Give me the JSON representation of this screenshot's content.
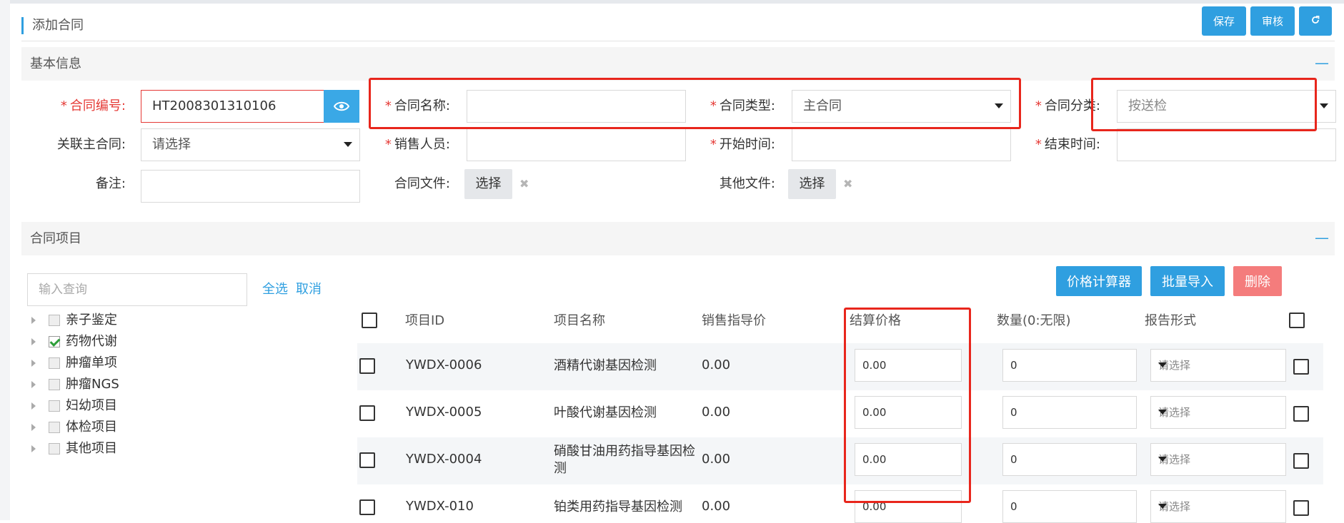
{
  "page": {
    "title": "添加合同"
  },
  "toolbar": {
    "save_label": "保存",
    "audit_label": "审核",
    "refresh_icon": "refresh-icon",
    "accent": "#2f9fe0"
  },
  "basic": {
    "section_label": "基本信息",
    "collapse": "—",
    "contract_no": {
      "label": "合同编号:",
      "value": "HT2008301310106"
    },
    "contract_name": {
      "label": "合同名称:",
      "value": ""
    },
    "contract_type": {
      "label": "合同类型:",
      "value": "主合同"
    },
    "contract_category": {
      "label": "合同分类:",
      "placeholder": "按送检"
    },
    "related_main": {
      "label": "关联主合同:",
      "value": "请选择"
    },
    "sales": {
      "label": "销售人员:",
      "value": ""
    },
    "start_time": {
      "label": "开始时间:",
      "value": ""
    },
    "end_time": {
      "label": "结束时间:",
      "value": ""
    },
    "remark": {
      "label": "备注:",
      "value": ""
    },
    "contract_file": {
      "label": "合同文件:",
      "button": "选择",
      "remove": "✖"
    },
    "other_file": {
      "label": "其他文件:",
      "button": "选择",
      "remove": "✖"
    }
  },
  "items": {
    "section_label": "合同项目",
    "collapse": "—",
    "search_placeholder": "输入查询",
    "select_all": "全选",
    "cancel": "取消",
    "tree": [
      {
        "label": "亲子鉴定",
        "checked": false
      },
      {
        "label": "药物代谢",
        "checked": true
      },
      {
        "label": "肿瘤单项",
        "checked": false
      },
      {
        "label": "肿瘤NGS",
        "checked": false
      },
      {
        "label": "妇幼项目",
        "checked": false
      },
      {
        "label": "体检项目",
        "checked": false
      },
      {
        "label": "其他项目",
        "checked": false
      }
    ],
    "buttons": {
      "calculator": "价格计算器",
      "import": "批量导入",
      "delete": "删除"
    },
    "columns": [
      "项目ID",
      "项目名称",
      "销售指导价",
      "结算价格",
      "数量(0:无限)",
      "报告形式"
    ],
    "rows": [
      {
        "id": "YWDX-0006",
        "name": "酒精代谢基因检测",
        "price": "0.00",
        "settle": "0.00",
        "qty": "0",
        "report": "请选择"
      },
      {
        "id": "YWDX-0005",
        "name": "叶酸代谢基因检测",
        "price": "0.00",
        "settle": "0.00",
        "qty": "0",
        "report": "请选择"
      },
      {
        "id": "YWDX-0004",
        "name": "硝酸甘油用药指导基因检测",
        "price": "0.00",
        "settle": "0.00",
        "qty": "0",
        "report": "请选择"
      },
      {
        "id": "YWDX-010",
        "name": "铂类用药指导基因检测",
        "price": "0.00",
        "settle": "0.00",
        "qty": "0",
        "report": "请选择"
      }
    ]
  }
}
